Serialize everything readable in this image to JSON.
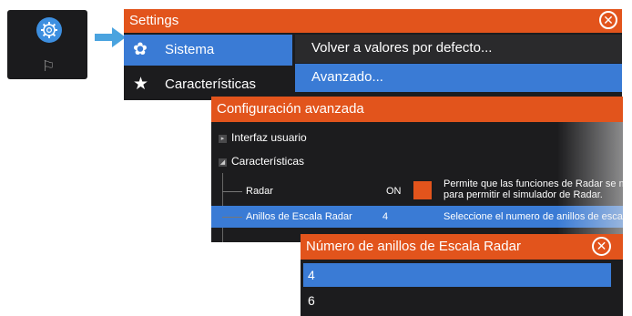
{
  "settings": {
    "title": "Settings",
    "sidebar": [
      {
        "label": "Sistema",
        "icon": "gear-icon",
        "selected": true
      },
      {
        "label": "Características",
        "icon": "star-icon",
        "selected": false
      }
    ],
    "options": [
      {
        "label": "Volver a valores por defecto...",
        "selected": false
      },
      {
        "label": "Avanzado...",
        "selected": true
      }
    ]
  },
  "config": {
    "title": "Configuración avanzada",
    "tree": {
      "interfaz": "Interfaz usuario",
      "caracteristicas": "Características",
      "radar": {
        "label": "Radar",
        "value": "ON",
        "desc_line1": "Permite que las funciones de Radar se m",
        "desc_line2": "para permitir el simulador de Radar."
      },
      "anillos": {
        "label": "Anillos de Escala Radar",
        "value": "4",
        "desc": "Seleccione el numero de anillos de escal"
      }
    }
  },
  "dialog": {
    "title": "Número de anillos de Escala Radar",
    "options": [
      {
        "label": "4",
        "selected": true
      },
      {
        "label": "6",
        "selected": false
      }
    ]
  },
  "colors": {
    "accent": "#e2541c",
    "selection": "#3a7bd5",
    "background": "#1c1c1e"
  }
}
